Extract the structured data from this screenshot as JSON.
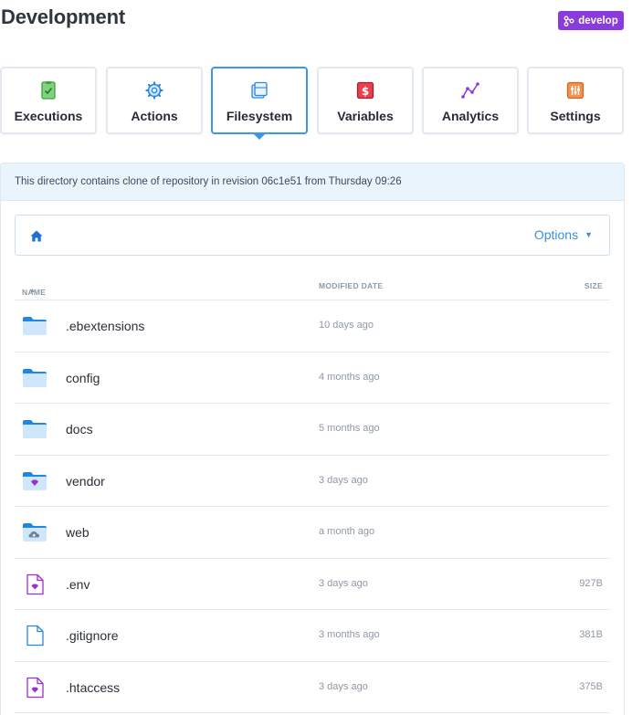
{
  "header": {
    "title": "Development",
    "branch": "develop"
  },
  "tabs": [
    {
      "label": "Executions",
      "icon": "executions-icon",
      "active": false
    },
    {
      "label": "Actions",
      "icon": "gear-icon",
      "active": false
    },
    {
      "label": "Filesystem",
      "icon": "files-icon",
      "active": true
    },
    {
      "label": "Variables",
      "icon": "variables-icon",
      "active": false
    },
    {
      "label": "Analytics",
      "icon": "analytics-icon",
      "active": false
    },
    {
      "label": "Settings",
      "icon": "settings-icon",
      "active": false
    }
  ],
  "info": {
    "text": "This directory contains clone of repository in revision 06c1e51 from Thursday 09:26"
  },
  "pathbar": {
    "options_label": "Options"
  },
  "table": {
    "columns": {
      "name": "NAME",
      "date": "MODIFIED DATE",
      "size": "SIZE"
    },
    "rows": [
      {
        "name": ".ebextensions",
        "date": "10 days ago",
        "size": "",
        "type": "folder"
      },
      {
        "name": "config",
        "date": "4 months ago",
        "size": "",
        "type": "folder"
      },
      {
        "name": "docs",
        "date": "5 months ago",
        "size": "",
        "type": "folder"
      },
      {
        "name": "vendor",
        "date": "3 days ago",
        "size": "",
        "type": "folder-gem"
      },
      {
        "name": "web",
        "date": "a month ago",
        "size": "",
        "type": "folder-cloud"
      },
      {
        "name": ".env",
        "date": "3 days ago",
        "size": "927B",
        "type": "file-gem"
      },
      {
        "name": ".gitignore",
        "date": "3 months ago",
        "size": "381B",
        "type": "file"
      },
      {
        "name": ".htaccess",
        "date": "3 days ago",
        "size": "375B",
        "type": "file-gem"
      }
    ]
  },
  "colors": {
    "accent": "#3b98e8",
    "branch_badge": "#8a3bdb",
    "info_bar_bg": "#eaf4fc",
    "folder": "#2b8fe6",
    "gem": "#9b2fd0"
  }
}
